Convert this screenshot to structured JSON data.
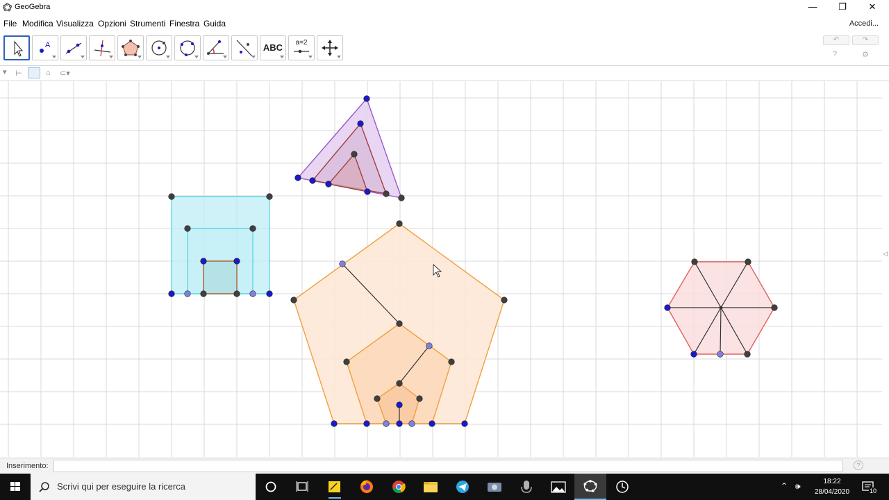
{
  "window": {
    "title": "GeoGebra",
    "minimize_glyph": "—",
    "restore_glyph": "❐",
    "close_glyph": "✕"
  },
  "menu": [
    "File",
    "Modifica",
    "Visualizza",
    "Opzioni",
    "Strumenti",
    "Finestra",
    "Guida"
  ],
  "account": {
    "sign_in": "Accedi..."
  },
  "toolbar": {
    "tools": [
      {
        "name": "move-tool",
        "icon": "cursor-arrow"
      },
      {
        "name": "point-tool",
        "icon": "point-a"
      },
      {
        "name": "line-tool",
        "icon": "line-two-points"
      },
      {
        "name": "perpendicular-tool",
        "icon": "perpendicular-line"
      },
      {
        "name": "polygon-tool",
        "icon": "polygon"
      },
      {
        "name": "circle-tool",
        "icon": "circle-center"
      },
      {
        "name": "circle-three-points-tool",
        "icon": "circle-three-points"
      },
      {
        "name": "angle-tool",
        "icon": "angle"
      },
      {
        "name": "reflect-tool",
        "icon": "reflect-line"
      },
      {
        "name": "text-tool",
        "icon": "text",
        "label": "ABC"
      },
      {
        "name": "slider-tool",
        "icon": "slider",
        "label": "a=2"
      },
      {
        "name": "move-view-tool",
        "icon": "move-arrows"
      }
    ],
    "undo_glyph": "↶",
    "redo_glyph": "↷"
  },
  "input_bar": {
    "label": "Inserimento:",
    "value": ""
  },
  "taskbar": {
    "search_placeholder": "Scrivi qui per eseguire la ricerca",
    "time": "18:22",
    "date": "28/04/2020",
    "notification_count": "10"
  },
  "colors": {
    "square_fill": "#bfeef5",
    "square_stroke": "#5fd5e6",
    "triangle_fill": "#e6d2f2",
    "triangle_stroke": "#9b59c9",
    "pentagon_fill": "#fde8d6",
    "pentagon_stroke": "#f0a040",
    "hexagon_fill": "#fbdede",
    "hexagon_stroke": "#e06060",
    "point_blue": "#1a1acc",
    "point_dark": "#404040",
    "point_light": "#8080e0",
    "grid": "#d8d8d8"
  }
}
